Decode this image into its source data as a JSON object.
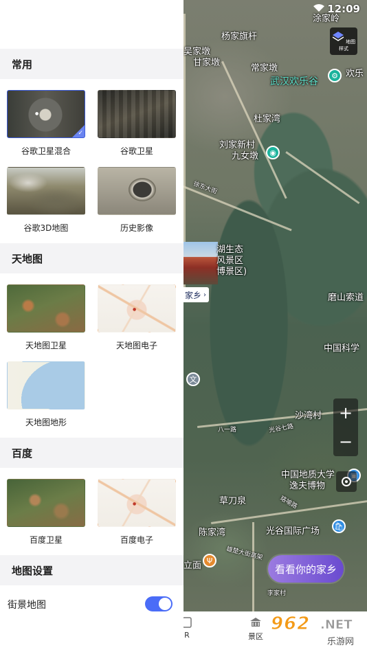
{
  "status_bar": {
    "time": "12:09"
  },
  "drawer": {
    "sections": [
      {
        "title": "常用",
        "tiles": [
          "谷歌卫星混合",
          "谷歌卫星",
          "谷歌3D地图",
          "历史影像"
        ]
      },
      {
        "title": "天地图",
        "tiles": [
          "天地图卫星",
          "天地图电子",
          "天地图地形"
        ]
      },
      {
        "title": "百度",
        "tiles": [
          "百度卫星",
          "百度电子"
        ]
      },
      {
        "title": "地图设置"
      }
    ],
    "selected_tile": "谷歌卫星混合",
    "street_view": {
      "label": "街景地图",
      "enabled": true
    }
  },
  "map": {
    "style_button_label": "地图样式",
    "zoom_in": "+",
    "zoom_out": "−",
    "labels": {
      "fangjia": "涂家岭",
      "yangjia": "杨家旗杆",
      "wujiadun": "吴家墩",
      "ganjiadun": "甘家墩",
      "changjiadun": "常家墩",
      "huanlegu": "武汉欢乐谷",
      "huanle2": "欢乐",
      "dujiawan": "杜家湾",
      "liujiaxincun": "刘家新村",
      "jiunvdun": "九女墩",
      "xudongdajie": "徐东大街",
      "scenic": "湖生态\n风景区\n博景区)",
      "hometown_chip": "家乡",
      "moshan": "磨山索道",
      "kexue": "中国科学",
      "shawancun": "沙湾村",
      "bayilu": "八一路",
      "guanggu": "光谷七路",
      "dizhi": "中国地质大学",
      "yifu": "逸夫博物",
      "caodaoquan": "草刀泉",
      "chenjiawan": "陈家湾",
      "guangguplaza": "光谷国际广场",
      "xiongchu": "雄楚大街高架",
      "lijiacun": "李家村",
      "lumian": "立面",
      "luoyu": "珞喻路"
    },
    "see_hometown_button": "看看你的家乡"
  },
  "bottom_nav": {
    "items": [
      "R",
      "景区"
    ]
  },
  "watermark": {
    "number": "962",
    "dot_net": ".NET",
    "site": "乐游网"
  }
}
